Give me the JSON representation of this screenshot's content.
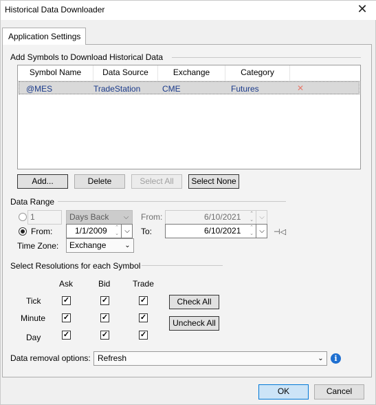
{
  "window": {
    "title": "Historical Data Downloader",
    "close_glyph": "✕"
  },
  "tabs": [
    {
      "label": "Application Settings"
    }
  ],
  "symbols_group": {
    "label": "Add Symbols to Download Historical Data"
  },
  "grid": {
    "columns": [
      "Symbol Name",
      "Data Source",
      "Exchange",
      "Category"
    ],
    "rows": [
      {
        "symbol": "@MES",
        "source": "TradeStation",
        "exchange": "CME",
        "category": "Futures",
        "delete_glyph": "✕"
      }
    ]
  },
  "grid_buttons": {
    "add": "Add...",
    "delete": "Delete",
    "select_all": "Select All",
    "select_none": "Select None"
  },
  "date_range": {
    "label": "Data Range",
    "days_back_value": "1",
    "days_back_unit": "Days Back",
    "from_label_top": "From:",
    "from_top_value": "6/10/2021",
    "from_radio_label": "From:",
    "from_value": "1/1/2009",
    "to_label": "To:",
    "to_value": "6/10/2021",
    "selected_option": "from",
    "timezone_label": "Time Zone:",
    "timezone_value": "Exchange"
  },
  "resolutions": {
    "label": "Select Resolutions for each Symbol",
    "columns": [
      "Ask",
      "Bid",
      "Trade"
    ],
    "rows": [
      {
        "name": "Tick",
        "ask": true,
        "bid": true,
        "trade": true
      },
      {
        "name": "Minute",
        "ask": true,
        "bid": true,
        "trade": true
      },
      {
        "name": "Day",
        "ask": true,
        "bid": true,
        "trade": true
      }
    ],
    "check_all": "Check All",
    "uncheck_all": "Uncheck All"
  },
  "data_removal": {
    "label": "Data removal options:",
    "value": "Refresh"
  },
  "footer": {
    "ok": "OK",
    "cancel": "Cancel"
  },
  "colors": {
    "accent": "#0078d7",
    "info": "#1e6fd0",
    "delete_x": "#e8796c",
    "grid_text": "#1a3a8a"
  }
}
